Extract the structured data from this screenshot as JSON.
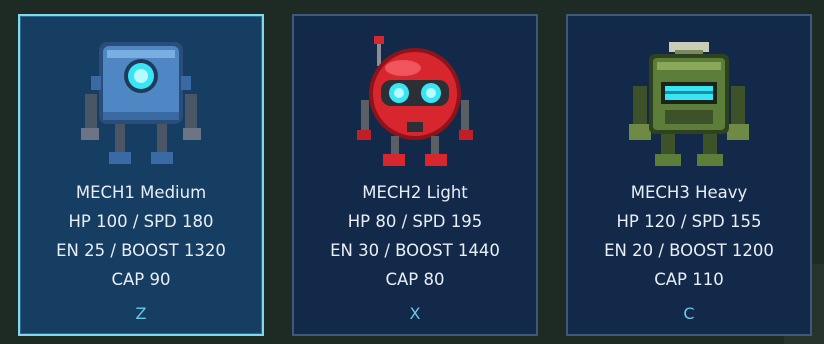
{
  "selected_index": 0,
  "mechs": [
    {
      "name": "MECH1 Medium",
      "stats_line1": "HP 100 / SPD 180",
      "stats_line2": "EN 25 / BOOST 1320",
      "stats_line3": "CAP 90",
      "key": "Z",
      "sprite_icon": "blue-robot-icon",
      "accent": "#4f8fd0"
    },
    {
      "name": "MECH2 Light",
      "stats_line1": "HP 80 / SPD 195",
      "stats_line2": "EN 30 / BOOST 1440",
      "stats_line3": "CAP 80",
      "key": "X",
      "sprite_icon": "red-robot-icon",
      "accent": "#d8262e"
    },
    {
      "name": "MECH3 Heavy",
      "stats_line1": "HP 120 / SPD 155",
      "stats_line2": "EN 20 / BOOST 1200",
      "stats_line3": "CAP 110",
      "key": "C",
      "sprite_icon": "green-robot-icon",
      "accent": "#5d7e3a"
    }
  ],
  "colors": {
    "card_bg": "#13294a",
    "card_selected_bg": "#163d62",
    "card_border": "#3f5a78",
    "card_selected_border": "#7fd8f0",
    "key_text": "#6ac7e6",
    "visor": "#39e4f5"
  }
}
